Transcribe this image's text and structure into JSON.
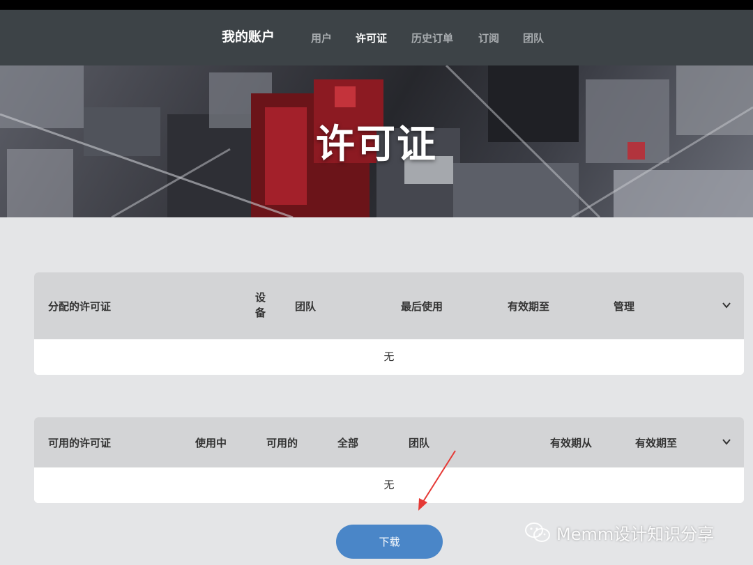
{
  "nav": {
    "brand": "我的账户",
    "items": [
      {
        "label": "用户",
        "active": false
      },
      {
        "label": "许可证",
        "active": true
      },
      {
        "label": "历史订单",
        "active": false
      },
      {
        "label": "订阅",
        "active": false
      },
      {
        "label": "团队",
        "active": false
      }
    ]
  },
  "hero": {
    "title": "许可证"
  },
  "assigned": {
    "columns": [
      "分配的许可证",
      "设备",
      "团队",
      "最后使用",
      "有效期至",
      "管理"
    ],
    "empty_text": "无"
  },
  "available": {
    "columns": [
      "可用的许可证",
      "使用中",
      "可用的",
      "全部",
      "团队",
      "有效期从",
      "有效期至"
    ],
    "empty_text": "无"
  },
  "download_label": "下载",
  "watermark": "Memm设计知识分享",
  "colors": {
    "navbar": "#3d4347",
    "page_bg": "#e4e5e7",
    "header_row": "#d3d4d6",
    "button": "#4a86c8",
    "arrow": "#e53935"
  }
}
